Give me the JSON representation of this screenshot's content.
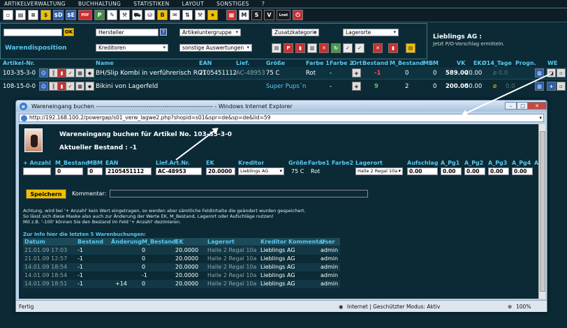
{
  "menu": [
    "ARTIKELVERWALTUNG",
    "BUCHHALTUNG",
    "STATISTIKEN",
    "LAYOUT",
    "SONSTIGES",
    "?"
  ],
  "toolbar_icons": [
    {
      "name": "new-icon",
      "glyph": "▫",
      "cls": "w"
    },
    {
      "name": "save-icon",
      "glyph": "▤",
      "cls": "w"
    },
    {
      "name": "list-icon",
      "glyph": "≡",
      "cls": "w"
    },
    {
      "name": "dollar-icon",
      "glyph": "$",
      "cls": "y"
    },
    {
      "name": "dollar-d-icon",
      "glyph": "$D",
      "cls": "b"
    },
    {
      "name": "dollar-e-icon",
      "glyph": "$E",
      "cls": "b"
    },
    {
      "name": "pdf-icon",
      "glyph": "PDF",
      "cls": "r"
    },
    {
      "name": "p-icon",
      "glyph": "P",
      "cls": "g"
    },
    {
      "name": "pen-icon",
      "glyph": "✎",
      "cls": "w"
    },
    {
      "name": "tools-icon",
      "glyph": "⚒",
      "cls": "w"
    },
    {
      "name": "truck-icon",
      "glyph": "⛟",
      "cls": "w"
    },
    {
      "name": "cart-icon",
      "glyph": "⛁",
      "cls": "w"
    },
    {
      "name": "b-icon",
      "glyph": "B",
      "cls": "y"
    },
    {
      "name": "mail-icon",
      "glyph": "✉",
      "cls": "w"
    },
    {
      "name": "sort-icon",
      "glyph": "⇅",
      "cls": "w"
    },
    {
      "name": "hammer-icon",
      "glyph": "⚒",
      "cls": "w"
    },
    {
      "name": "star-icon",
      "glyph": "★",
      "cls": "y"
    },
    {
      "name": "sep",
      "glyph": "",
      "cls": "sep"
    },
    {
      "name": "pictures-icon",
      "glyph": "▦",
      "cls": "r"
    },
    {
      "name": "m-icon",
      "glyph": "M",
      "cls": "w"
    },
    {
      "name": "s-icon",
      "glyph": "S",
      "cls": "k"
    },
    {
      "name": "v-icon",
      "glyph": "V",
      "cls": "k"
    },
    {
      "name": "lnet-icon",
      "glyph": "Lnet",
      "cls": "k"
    },
    {
      "name": "power-icon",
      "glyph": "⏻",
      "cls": "r"
    }
  ],
  "filter": {
    "search_value": "",
    "ok_label": "OK",
    "hersteller": "Hersteller",
    "help": "?",
    "artikeluntergruppe": "Artikeluntergruppe",
    "zusatzkategorie": "Zusatzkategorie",
    "lagerorte": "Lagerorte",
    "warendisposition": "Warendisposition",
    "kreditoren": "Kreditoren",
    "sonstige": "sonstige Auswertungen",
    "lieblings": "Lieblings AG :",
    "lieblings_sub": "Jetzt P/O-Vorschlag ermitteln."
  },
  "table": {
    "headers": [
      "Artikel-Nr.",
      "Name",
      "EAN",
      "Lief.",
      "Größe",
      "Farbe 1",
      "Farbe 2",
      "Ort",
      "Bestand",
      "M_Bestand",
      "MBM",
      "VK",
      "EK",
      "Ø14_Tage",
      "Progn.",
      "WE"
    ],
    "rows": [
      {
        "nr": "103-35-3-0",
        "name": "BH/Slip Kombi in verführerisch ROT",
        "ean": "2105451112",
        "lief": "AC-48953",
        "groesse": "75 C",
        "farbe1": "Rot",
        "farbe2": "-",
        "bestand": "-1",
        "mbestand": "0",
        "mbm": "0",
        "vk": "589.00",
        "ek": "20.00",
        "avg": "ø 0.0",
        "progn": ""
      },
      {
        "nr": "108-15-0-0",
        "name": "Bikini von Lagerfeld",
        "ean": "",
        "lief": "",
        "groesse": "Super Pups´n",
        "farbe1": "-",
        "farbe2": "",
        "bestand": "9",
        "mbestand": "2",
        "mbm": "0",
        "vk": "200.00",
        "ek": "50.00",
        "avg": "ø",
        "progn": "0.0"
      }
    ]
  },
  "ie": {
    "title": "Wareneingang buchen ---------------------------------------------------------- - Windows Internet Explorer",
    "url": "http://192.168.100.2/powergap/s01_verw_lagwe2.php?shopid=s01&spr=de&sp=de&lid=59",
    "status_left": "Fertig",
    "status_mid": "Internet | Geschützter Modus: Aktiv",
    "zoom": "100%"
  },
  "form": {
    "title": "Wareneingang buchen für Artikel No. 103-35-3-0",
    "bestand": "Aktueller Bestand : -1",
    "headers": [
      "+ Anzahl",
      "M_Bestand",
      "MBM",
      "EAN",
      "Lief.Art.Nr.",
      "EK",
      "Kreditor",
      "Größe",
      "Farbe1",
      "Farbe2",
      "Lagerort",
      "Aufschlag",
      "A_Pg1",
      "A_Pg2",
      "A_Pg3",
      "A_Pg4",
      "A"
    ],
    "anzahl": "",
    "mbestand": "0",
    "mbm": "0",
    "ean": "2105451112",
    "liefartnr": "AC-48953",
    "ek": "20.0000",
    "kreditor": "Lieblings AG",
    "groesse": "75 C",
    "farbe1": "Rot",
    "farbe2": "",
    "lagerort": "Halle 2 Regal 10a",
    "aufschlag": "0.00",
    "apg1": "0.00",
    "apg2": "0.00",
    "apg3": "0.00",
    "apg4": "0.00",
    "save": "Speichern",
    "kommentar": "Kommentar:",
    "note1": "Achtung, wird bei '+ Anzahl' kein Wert eingetragen, so werden aber sämtliche Feldinhalte die geändert wurden gespeichert.",
    "note2": "So lässt sich diese Maske also auch zur Änderung der Werte EK, M_Bestand, Lagerort oder Aufschläge nutzen!",
    "note3": "Mit z.B. '-100' können Sie den Bestand im Feld '+ Anzahl' dezimieren.",
    "hist_title": "Zur Info hier die letzten 5 Warenbuchungen:",
    "hist_headers": [
      "Datum",
      "Bestand",
      "Änderung",
      "M_Bestand",
      "EK",
      "Lagerort",
      "Kreditor",
      "Kommentar",
      "User"
    ],
    "hist_rows": [
      {
        "datum": "21.01.09 17:03",
        "bestand": "-1",
        "aend": "",
        "mb": "0",
        "ek": "20.0000",
        "lager": "Halle 2 Regal 10a",
        "kred": "Lieblings AG",
        "user": "admin"
      },
      {
        "datum": "21.01.09 12:57",
        "bestand": "-1",
        "aend": "",
        "mb": "0",
        "ek": "20.0000",
        "lager": "Halle 2 Regal 10a",
        "kred": "Lieblings AG",
        "user": "admin"
      },
      {
        "datum": "14.01.09 18:54",
        "bestand": "-1",
        "aend": "",
        "mb": "0",
        "ek": "20.0000",
        "lager": "Halle 2 Regal 10a",
        "kred": "Lieblings AG",
        "user": "admin"
      },
      {
        "datum": "14.01.09 18:54",
        "bestand": "-1",
        "aend": "",
        "mb": "-1",
        "ek": "20.0000",
        "lager": "Halle 2 Regal 10a",
        "kred": "Lieblings AG",
        "user": "admin"
      },
      {
        "datum": "14.01.09 18:51",
        "bestand": "-1",
        "aend": "+14",
        "mb": "0",
        "ek": "20.0000",
        "lager": "Halle 2 Regal 10a",
        "kred": "Lieblings AG",
        "user": "admin"
      }
    ]
  }
}
